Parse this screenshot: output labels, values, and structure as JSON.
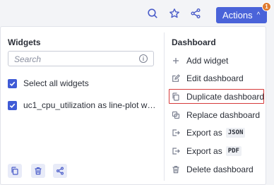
{
  "toolbar": {
    "actions_label": "Actions",
    "actions_chevron": "^",
    "notification_count": "1",
    "icons": [
      "search-icon",
      "star-icon",
      "share-icon"
    ]
  },
  "widgets": {
    "title": "Widgets",
    "search_placeholder": "Search",
    "info_glyph": "i",
    "select_all_label": "Select all widgets",
    "items": [
      {
        "label": "uc1_cpu_utilization as line-plot wh…",
        "checked": true
      }
    ],
    "footer_icons": [
      "copy-icon",
      "trash-icon",
      "share-icon"
    ]
  },
  "dashboard_menu": {
    "title": "Dashboard",
    "items": [
      {
        "label": "Add widget",
        "icon": "plus-icon"
      },
      {
        "label": "Edit dashboard",
        "icon": "edit-icon"
      },
      {
        "label": "Duplicate dashboard",
        "icon": "copy-icon",
        "highlighted": true
      },
      {
        "label": "Replace dashboard",
        "icon": "replace-icon"
      },
      {
        "label": "Export as",
        "tag": "JSON",
        "icon": "export-icon"
      },
      {
        "label": "Export as",
        "tag": "PDF",
        "icon": "export-icon"
      },
      {
        "label": "Delete dashboard",
        "icon": "trash-icon"
      }
    ]
  },
  "colors": {
    "accent": "#4a63d9",
    "highlight_border": "#d63b3b",
    "badge": "#e07a2e"
  }
}
